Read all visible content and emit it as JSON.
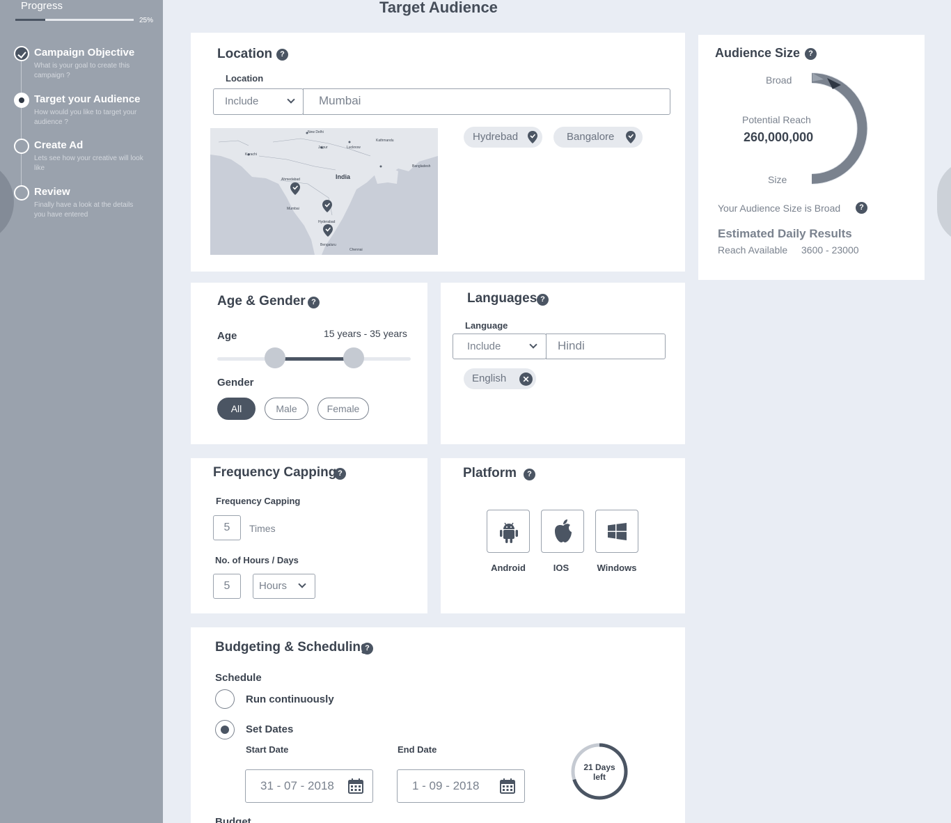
{
  "sidebar": {
    "progress_title": "Progress",
    "progress_percent": "25%",
    "progress_value": 0.25,
    "steps": [
      {
        "title": "Campaign Objective",
        "desc": "What is your goal to create this campaign ?",
        "state": "done"
      },
      {
        "title": "Target your Audience",
        "desc": "How would you like to target your audience ?",
        "state": "active"
      },
      {
        "title": "Create Ad",
        "desc": "Lets see how your creative will look like",
        "state": "pending"
      },
      {
        "title": "Review",
        "desc": "Finally have a look at the details you have entered",
        "state": "pending"
      }
    ]
  },
  "page_title": "Target Audience",
  "location": {
    "title": "Location",
    "field_label": "Location",
    "mode": "Include",
    "value": "Mumbai",
    "chips": [
      "Hydrebad",
      "Bangalore"
    ],
    "map_labels": [
      "India",
      "Hyderabad",
      "Ahmedabad",
      "Mumbai",
      "Jaipur",
      "Lucknow",
      "Karachi",
      "Kathmandu",
      "Bangladesh",
      "New Delhi",
      "Chennai",
      "Bengaluru"
    ]
  },
  "age_gender": {
    "title": "Age & Gender",
    "age_label": "Age",
    "age_range": "15 years - 35 years",
    "gender_label": "Gender",
    "genders": [
      "All",
      "Male",
      "Female"
    ],
    "selected_gender": "All"
  },
  "languages": {
    "title": "Languages",
    "field_label": "Language",
    "mode": "Include",
    "value": "Hindi",
    "chips": [
      "English"
    ]
  },
  "frequency": {
    "title": "Frequency Capping",
    "field_label": "Frequency Capping",
    "times_value": "5",
    "times_label": "Times",
    "hours_label": "No. of Hours / Days",
    "hours_value": "5",
    "unit": "Hours"
  },
  "platform": {
    "title": "Platform",
    "items": [
      "Android",
      "IOS",
      "Windows"
    ]
  },
  "budget": {
    "title": "Budgeting & Scheduling",
    "schedule_label": "Schedule",
    "run_continuously": "Run continuously",
    "set_dates": "Set Dates",
    "start_label": "Start Date",
    "start_value": "31 - 07 - 2018",
    "end_label": "End Date",
    "end_value": "1 - 09 - 2018",
    "days_left_number": "21 Days",
    "days_left_word": "left",
    "days_left_fraction": 0.7,
    "budget_label": "Budget"
  },
  "audience": {
    "title": "Audience Size",
    "broad": "Broad",
    "potential_reach": "Potential Reach",
    "reach_value": "260,000,000",
    "size": "Size",
    "status": "Your Audience Size is Broad",
    "daily_title": "Estimated Daily Results",
    "reach_available_label": "Reach Available",
    "reach_available_value": "3600 - 23000"
  },
  "colors": {
    "sidebar": "#9aa2ad",
    "accent": "#4b5563",
    "background": "#e9edf4"
  }
}
